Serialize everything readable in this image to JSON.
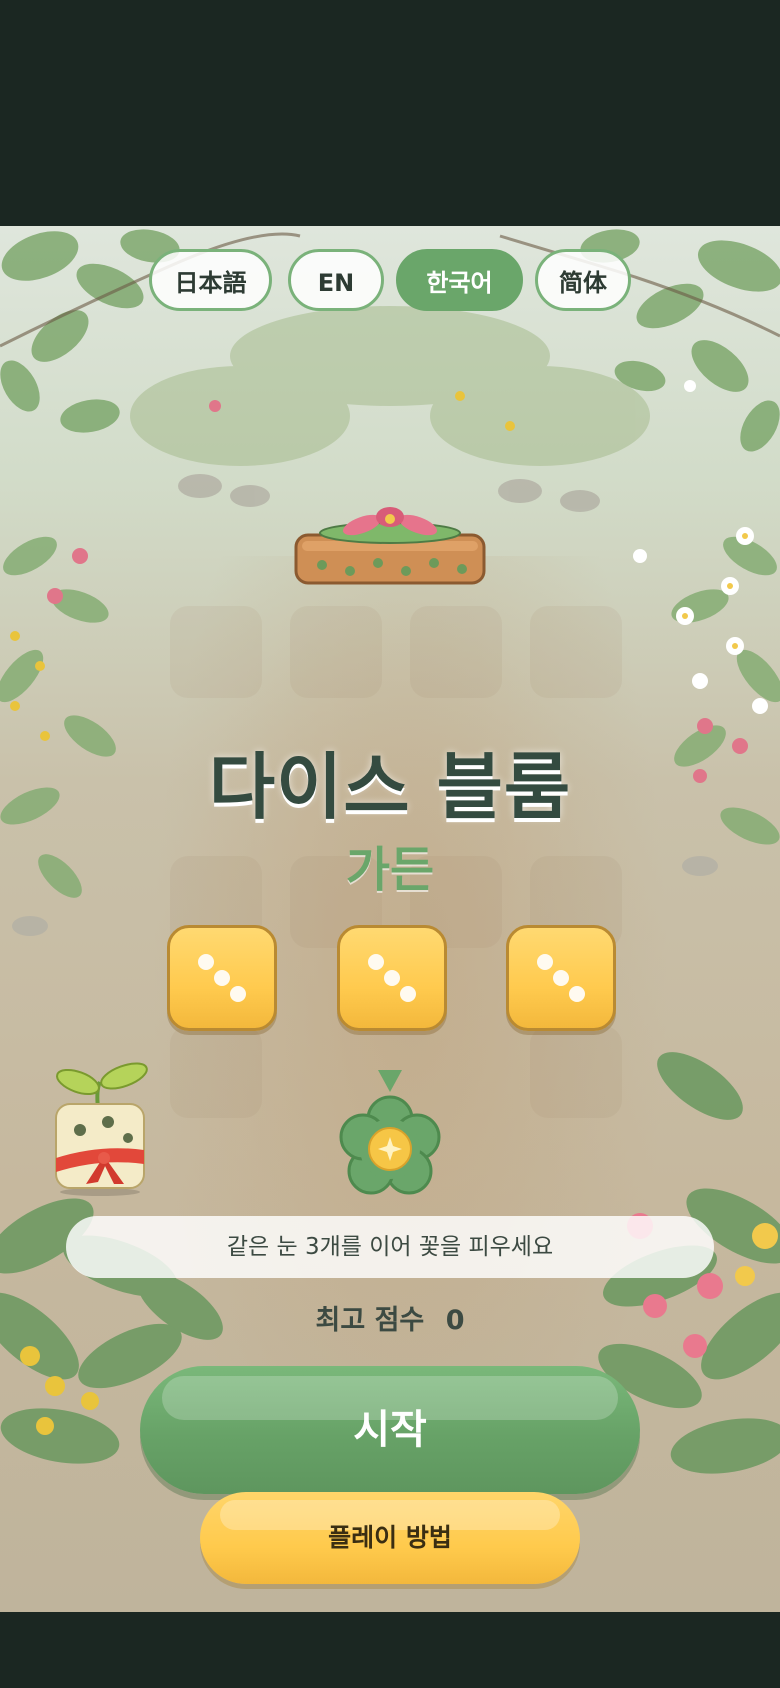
{
  "languages": [
    {
      "label": "日本語",
      "active": false
    },
    {
      "label": "EN",
      "active": false
    },
    {
      "label": "한국어",
      "active": true
    },
    {
      "label": "简体",
      "active": false
    }
  ],
  "title": "다이스 블룸",
  "subtitle": "가든",
  "dice": [
    {
      "face": 3
    },
    {
      "face": 3
    },
    {
      "face": 3
    }
  ],
  "instruction": "같은 눈 3개를 이어 꽃을 피우세요",
  "best_score": {
    "label": "최고 점수",
    "value": "0"
  },
  "start_button": "시작",
  "howto_button": "플레이 방법",
  "icons": {
    "mascot": "sprout-dice-mascot-icon",
    "planter": "flower-planter-icon",
    "flower": "flower-icon",
    "arrow": "down-arrow-icon"
  },
  "colors": {
    "primary_green": "#6aa66a",
    "dice_yellow": "#ffca4e",
    "title_dark": "#344b40",
    "background": "#1b2722"
  }
}
